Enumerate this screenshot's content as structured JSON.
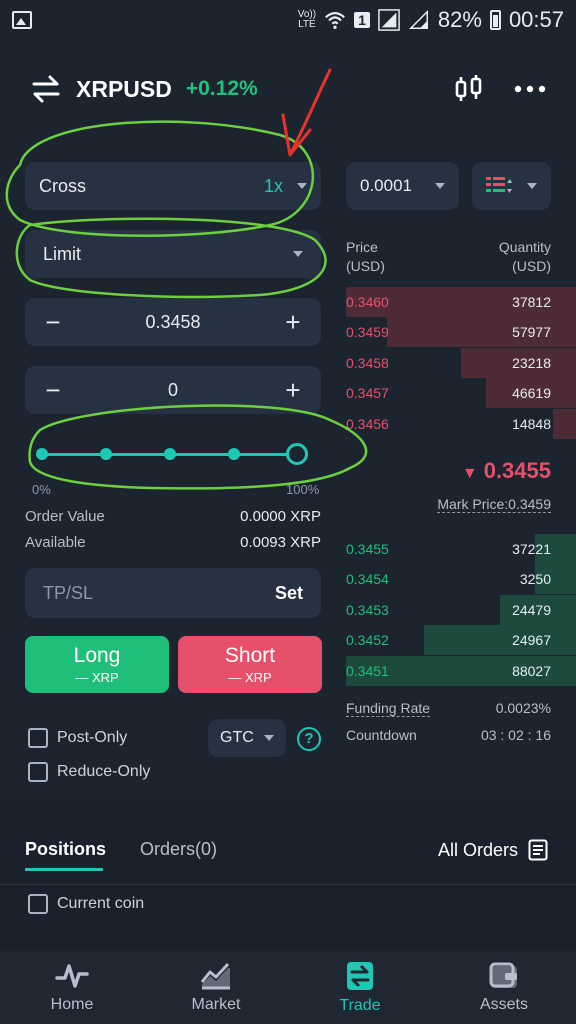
{
  "status_bar": {
    "net_label_top": "Vo))",
    "net_label_bottom": "LTE",
    "sim_badge": "1",
    "battery": "82%",
    "time": "00:57"
  },
  "header": {
    "pair": "XRPUSD",
    "change": "+0.12%"
  },
  "order_form": {
    "margin_mode": "Cross",
    "leverage": "1x",
    "order_type": "Limit",
    "price": "0.3458",
    "amount": "0",
    "slider_min": "0%",
    "slider_max": "100%",
    "slider_value": 1.0,
    "order_value_label": "Order Value",
    "order_value": "0.0000 XRP",
    "available_label": "Available",
    "available": "0.0093 XRP",
    "tpsl_label": "TP/SL",
    "tpsl_set": "Set",
    "long_label": "Long",
    "long_sub": "— XRP",
    "short_label": "Short",
    "short_sub": "— XRP",
    "post_only": "Post-Only",
    "reduce_only": "Reduce-Only",
    "tif": "GTC",
    "help": "?"
  },
  "orderbook": {
    "precision": "0.0001",
    "price_head": "Price",
    "price_unit": "(USD)",
    "qty_head": "Quantity",
    "qty_unit": "(USD)",
    "asks": [
      {
        "price": "0.3460",
        "qty": "37812",
        "depth": 1.0
      },
      {
        "price": "0.3459",
        "qty": "57977",
        "depth": 0.82
      },
      {
        "price": "0.3458",
        "qty": "23218",
        "depth": 0.5
      },
      {
        "price": "0.3457",
        "qty": "46619",
        "depth": 0.39
      },
      {
        "price": "0.3456",
        "qty": "14848",
        "depth": 0.1
      }
    ],
    "last_price": "0.3455",
    "mark_price": "Mark Price:0.3459",
    "bids": [
      {
        "price": "0.3455",
        "qty": "37221",
        "depth": 0.18
      },
      {
        "price": "0.3454",
        "qty": "3250",
        "depth": 0.18
      },
      {
        "price": "0.3453",
        "qty": "24479",
        "depth": 0.33
      },
      {
        "price": "0.3452",
        "qty": "24967",
        "depth": 0.66
      },
      {
        "price": "0.3451",
        "qty": "88027",
        "depth": 1.0
      }
    ],
    "funding_label": "Funding Rate",
    "funding_value": "0.0023%",
    "countdown_label": "Countdown",
    "countdown_value": "03 : 02 : 16"
  },
  "positions": {
    "tab_positions": "Positions",
    "tab_orders": "Orders(0)",
    "all_orders": "All Orders",
    "current_coin": "Current coin"
  },
  "nav": [
    {
      "label": "Home",
      "icon": "home-pulse-icon"
    },
    {
      "label": "Market",
      "icon": "market-chart-icon"
    },
    {
      "label": "Trade",
      "icon": "trade-icon"
    },
    {
      "label": "Assets",
      "icon": "wallet-icon"
    }
  ],
  "colors": {
    "green": "#1fbf79",
    "red": "#e7506a",
    "accent": "#20c7b4",
    "bg": "#1c2430",
    "annotation": "#6ccf3f",
    "arrow": "#e8332c"
  }
}
